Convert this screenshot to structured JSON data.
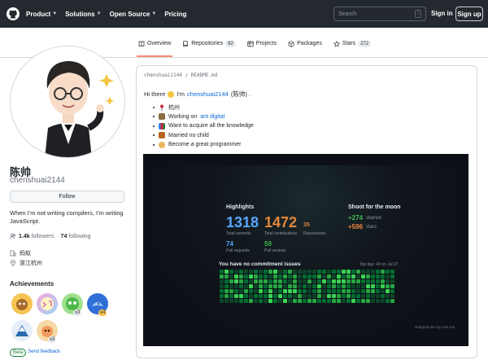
{
  "header": {
    "nav": [
      "Product",
      "Solutions",
      "Open Source",
      "Pricing"
    ],
    "search_placeholder": "Search",
    "search_shortcut": "/",
    "sign_in": "Sign in",
    "sign_up": "Sign up"
  },
  "tabs": [
    {
      "label": "Overview",
      "count": null,
      "icon": "book-icon",
      "active": true
    },
    {
      "label": "Repositories",
      "count": "92",
      "icon": "repo-icon"
    },
    {
      "label": "Projects",
      "count": null,
      "icon": "table-icon"
    },
    {
      "label": "Packages",
      "count": null,
      "icon": "package-icon"
    },
    {
      "label": "Stars",
      "count": "272",
      "icon": "star-icon"
    }
  ],
  "profile": {
    "name": "陈帅",
    "login": "chenshuai2144",
    "follow_label": "Follow",
    "bio": "When I'm not writing compilers, I'm writing JavaScript.",
    "followers": "1.4k",
    "followers_label": "followers",
    "following": "74",
    "following_label": "following",
    "org": "蚂蚁",
    "location": "浙江杭州",
    "achievements_title": "Achievements",
    "badges": [
      {
        "name": "starstruck-badge",
        "count": ""
      },
      {
        "name": "yolo-badge",
        "count": ""
      },
      {
        "name": "pair-extraordinaire-badge",
        "count": "x3"
      },
      {
        "name": "pull-shark-badge",
        "count": "x4"
      },
      {
        "name": "arctic-code-vault-badge",
        "count": ""
      },
      {
        "name": "galaxy-brain-badge",
        "count": "x3"
      }
    ],
    "beta": "Beta",
    "send_feedback": "Send feedback"
  },
  "readme": {
    "breadcrumb": "chenshuai2144 / README.md",
    "greeting_prefix": "Hi there",
    "greeting_mid": "I'm",
    "greeting_link": "chenshuai2144",
    "greeting_suffix": "(陈帅) .",
    "items": [
      {
        "icon": "pin-icon",
        "text": "杭州",
        "link": ""
      },
      {
        "icon": "laptop-icon",
        "text": "Working on",
        "link": "ant digital"
      },
      {
        "icon": "books-icon",
        "text": "Want to acquire all the knowledge",
        "link": ""
      },
      {
        "icon": "ring-icon",
        "text": "Married no child",
        "link": ""
      },
      {
        "icon": "person-icon",
        "text": "Become a great programmer",
        "link": ""
      }
    ]
  },
  "stats_card": {
    "highlights_title": "Highlights",
    "total_commits": "1318",
    "total_commits_label": "Total commits",
    "total_contributions": "1472",
    "total_contributions_label": "Total contributions",
    "repositories": "35",
    "repositories_label": "Repositories",
    "pull_requests": "74",
    "pull_requests_label": "Pull requests",
    "pull_reviews": "59",
    "pull_reviews_label": "Pull reviews",
    "moon_title": "Shoot for the moon",
    "starred": "+274",
    "starred_label": "starred",
    "stars": "+596",
    "stars_label": "stars",
    "commitment": "You have no commitment issues",
    "top_day": "Top day: 43 on Jul 27",
    "footer": "wrapped.dev by next.run"
  },
  "colors": {
    "header_bg": "#24292f",
    "tab_underline": "#fd8c73",
    "link": "#0969da",
    "commits_blue": "#58a6ff",
    "contrib_orange": "#e3883b",
    "moon_green": "#3fb950",
    "moon_orange": "#f0883e"
  }
}
